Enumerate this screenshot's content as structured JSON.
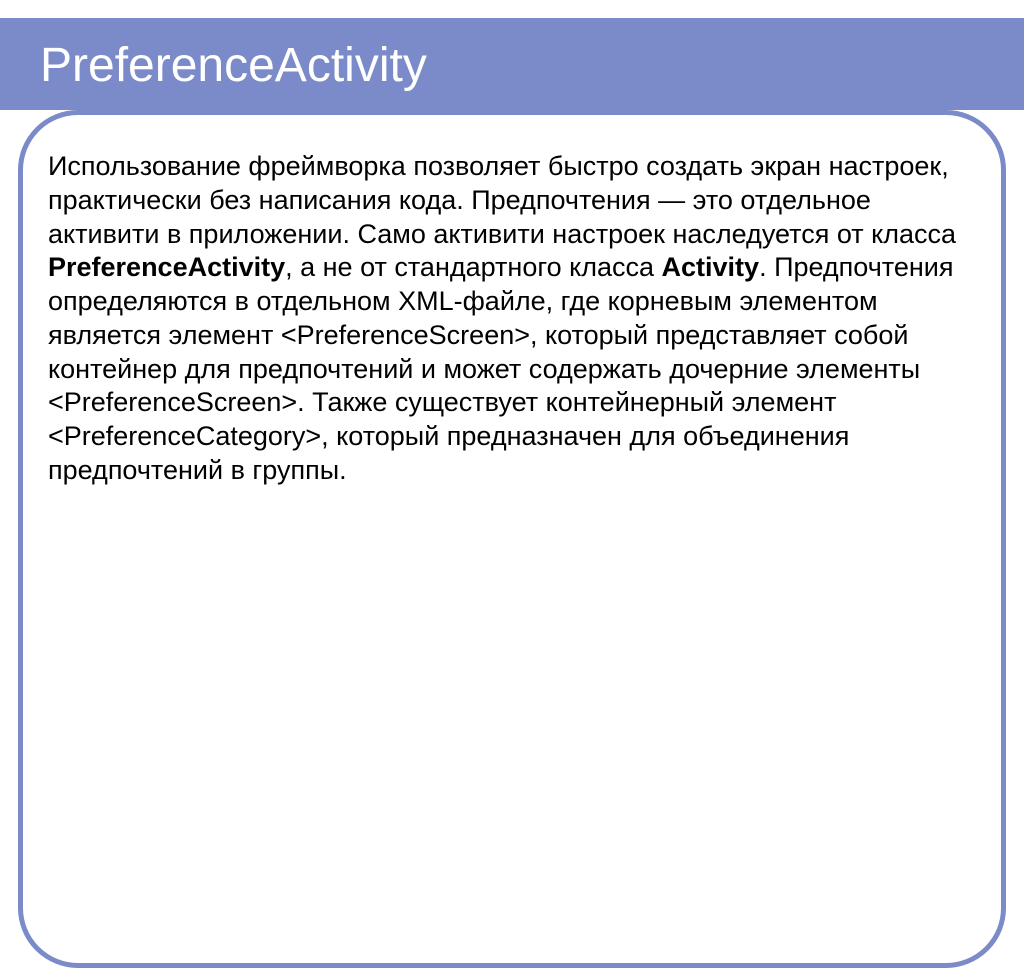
{
  "slide": {
    "title": "PreferenceActivity",
    "body": {
      "p1a": "Использование фреймворка позволяет быстро создать экран настроек, практически без написания кода. Предпочтения — это отдельное активити в приложении. Само активити настроек наследуется от класса ",
      "b1": "PreferenceActivity",
      "p1b": ", а не от стандартного класса ",
      "b2": "Activity",
      "p1c": ". Предпочтения определяются в отдельном XML-файле, где корневым элементом является элемент <PreferenceScreen>, который представляет собой контейнер для предпочтений и может содержать дочерние элементы <PreferenceScreen>. Также существует контейнерный элемент <PreferenceCategory>, который предназначен для объединения предпочтений в группы."
    }
  }
}
